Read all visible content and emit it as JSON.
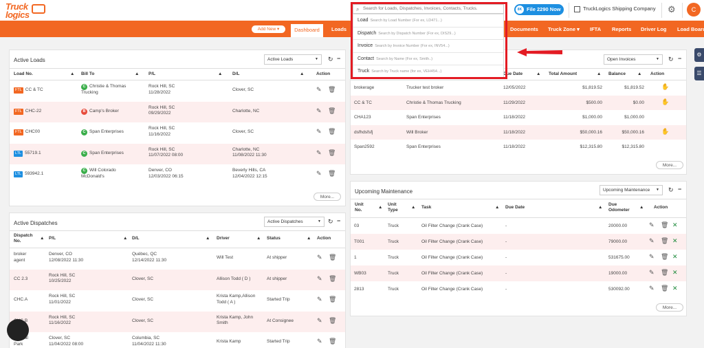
{
  "topbar": {
    "logo_line1": "Truck",
    "logo_line2": "logics",
    "search_placeholder": "Search for Loads, Dispatches, Invoices, Contacts, Trucks.",
    "f2290_label": "File 2290 Now",
    "f2290_badge": "8K",
    "company": "TruckLogics Shipping Company",
    "avatar": "C",
    "icons": {
      "search": "search-icon",
      "settings": "gear-icon",
      "company": "building-icon"
    }
  },
  "search_dropdown": [
    {
      "label": "Load",
      "hint": "Search by Load Number (For ex, LD471...)"
    },
    {
      "label": "Dispatch",
      "hint": "Search by Dispatch Number (For ex, DIS29...)"
    },
    {
      "label": "Invoice",
      "hint": "Search by Invoice Number (For ex, INV54...)"
    },
    {
      "label": "Contact",
      "hint": "Search by Name (For ex, Smith..)"
    },
    {
      "label": "Truck",
      "hint": "Search by Truck name (for ex, VEH454...)"
    }
  ],
  "nav": {
    "add_new": "Add New ▾",
    "items": [
      "Dashboard",
      "Loads",
      "Documents",
      "Truck Zone ▾",
      "IFTA",
      "Reports",
      "Driver Log",
      "Load Board"
    ]
  },
  "active_loads": {
    "title": "Active Loads",
    "select": "Active Loads",
    "headers": [
      "Load No.",
      "Bill To",
      "P/L",
      "D/L",
      "Action"
    ],
    "more": "More...",
    "rows": [
      {
        "tag": "FTL",
        "load": "CC & TC",
        "badge": "C",
        "bill1": "Christie & Thomas",
        "bill2": "Trucking",
        "pl1": "Rock Hill, SC",
        "pl2": "11/28/2022",
        "dl1": "Clover, SC",
        "dl2": ""
      },
      {
        "tag": "FTL",
        "load": "CHC-22",
        "badge": "B",
        "bill1": "Camp's Broker",
        "bill2": "",
        "pl1": "Rock Hill, SC",
        "pl2": "09/29/2022",
        "dl1": "Charlotte, NC",
        "dl2": ""
      },
      {
        "tag": "FTL",
        "load": "CHC00",
        "badge": "C",
        "bill1": "Span Enterprises",
        "bill2": "",
        "pl1": "Rock Hill, SC",
        "pl2": "11/16/2022",
        "dl1": "Clover, SC",
        "dl2": ""
      },
      {
        "tag": "LTL",
        "load": "55719.1",
        "badge": "C",
        "bill1": "Span Enterprises",
        "bill2": "",
        "pl1": "Rock Hill, SC",
        "pl2": "11/07/2022 08:00",
        "dl1": "Charlotte, NC",
        "dl2": "11/08/2022 11:30"
      },
      {
        "tag": "LTL",
        "load": "593942.1",
        "badge": "C",
        "bill1": "Will Colorado",
        "bill2": "McDonald's",
        "pl1": "Denver, CO",
        "pl2": "12/03/2022 06:15",
        "dl1": "Beverly Hills, CA",
        "dl2": "12/04/2022 12:15"
      }
    ]
  },
  "active_dispatches": {
    "title": "Active Dispatches",
    "select": "Active Dispatches",
    "headers": [
      "Dispatch",
      "No.",
      "P/L",
      "D/L",
      "Driver",
      "Status",
      "Action"
    ],
    "rows": [
      {
        "d1": "broker",
        "d2": "agent",
        "pl1": "Denver, CO",
        "pl2": "12/08/2022 11:30",
        "dl1": "Québec, QC",
        "dl2": "12/14/2022 11:30",
        "dr1": "Will Test",
        "dr2": "",
        "status": "At shipper"
      },
      {
        "d1": "CC 2.3",
        "d2": "",
        "pl1": "Rock Hill, SC",
        "pl2": "10/25/2022",
        "dl1": "Clover, SC",
        "dl2": "",
        "dr1": "Allison Todd ( D )",
        "dr2": "",
        "status": "At shipper"
      },
      {
        "d1": "CHC.A",
        "d2": "",
        "pl1": "Rock Hill, SC",
        "pl2": "11/01/2022",
        "dl1": "Clover, SC",
        "dl2": "",
        "dr1": "Krista Kamp,Allison",
        "dr2": "Todd ( A )",
        "status": "Started Trip"
      },
      {
        "d1": "CHC.B",
        "d2": "",
        "pl1": "Rock Hill, SC",
        "pl2": "11/16/2022",
        "dl1": "Clover, SC",
        "dl2": "",
        "dr1": "Krista Kamp, John",
        "dr2": "Smith",
        "status": "At Consignee"
      },
      {
        "d1": "Central",
        "d2": "Park",
        "pl1": "Clover, SC",
        "pl2": "11/04/2022 08:00",
        "dl1": "Columbia, SC",
        "dl2": "11/04/2022 11:30",
        "dr1": "Krista Kamp",
        "dr2": "",
        "status": "Started Trip"
      }
    ]
  },
  "open_invoices": {
    "select": "Open Invoices",
    "headers": [
      "Due Date",
      "Total Amount",
      "Balance",
      "Action"
    ],
    "more": "More...",
    "rows": [
      {
        "inv": "brokerage",
        "cust": "Trucker test broker",
        "due": "12/05/2022",
        "total": "$1,819.52",
        "bal": "$1,819.52",
        "pay": true
      },
      {
        "inv": "CC & TC",
        "cust": "Christie & Thomas Trucking",
        "due": "11/29/2022",
        "total": "$500.00",
        "bal": "$0.00",
        "pay": true
      },
      {
        "inv": "CHA123",
        "cust": "Span Enterprises",
        "due": "11/18/2022",
        "total": "$1,000.00",
        "bal": "$1,000.00",
        "pay": false
      },
      {
        "inv": "dsfhdsfsfj",
        "cust": "Will Broker",
        "due": "11/18/2022",
        "total": "$50,000.16",
        "bal": "$50,000.16",
        "pay": true
      },
      {
        "inv": "Span2592",
        "cust": "Span Enterprises",
        "due": "11/18/2022",
        "total": "$12,315.80",
        "bal": "$12,315.80",
        "pay": false
      }
    ]
  },
  "maintenance": {
    "title": "Upcoming Maintenance",
    "select": "Upcoming Maintenance",
    "headers": [
      "Unit",
      "No.",
      "Unit",
      "Type",
      "Task",
      "Due Date",
      "Due",
      "Odometer",
      "Action"
    ],
    "more": "More...",
    "rows": [
      {
        "unit": "03",
        "type": "Truck",
        "task": "Oil Filter Change (Crank Case)",
        "due": "-",
        "odo": "20000.00"
      },
      {
        "unit": "T001",
        "type": "Truck",
        "task": "Oil Filter Change (Crank Case)",
        "due": "-",
        "odo": "79000.00"
      },
      {
        "unit": "1",
        "type": "Truck",
        "task": "Oil Filter Change (Crank Case)",
        "due": "-",
        "odo": "531675.00"
      },
      {
        "unit": "WB03",
        "type": "Truck",
        "task": "Oil Filter Change (Crank Case)",
        "due": "-",
        "odo": "19000.00"
      },
      {
        "unit": "2813",
        "type": "Truck",
        "task": "Oil Filter Change (Crank Case)",
        "due": "-",
        "odo": "530092.00"
      }
    ]
  },
  "colors": {
    "brand": "#f26722",
    "highlight": "#e31b23",
    "alt_row": "#fdeeee"
  }
}
